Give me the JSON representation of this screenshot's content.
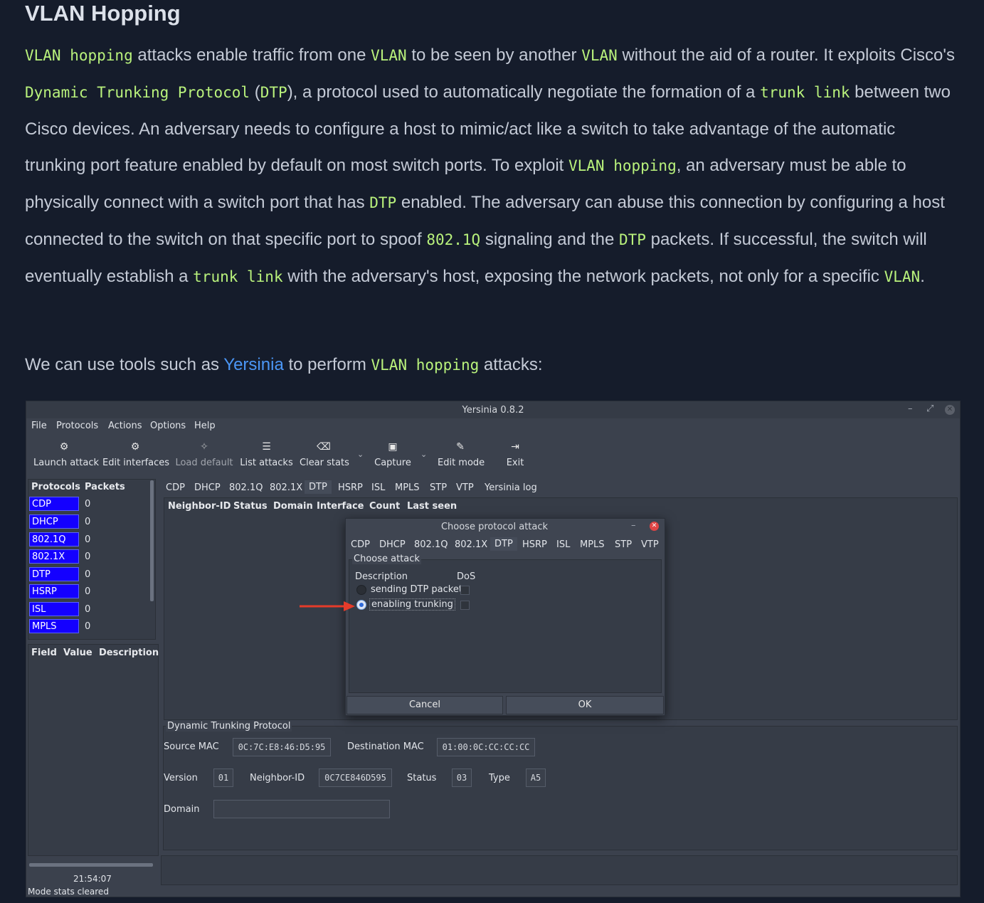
{
  "article": {
    "heading": "VLAN Hopping",
    "p1": {
      "s0": "VLAN hopping",
      "s1": " attacks enable traffic from one ",
      "s2": "VLAN",
      "s3": " to be seen by another ",
      "s4": "VLAN",
      "s5": " without the aid of a router. It exploits Cisco's ",
      "s6": "Dynamic Trunking Protocol",
      "s7": " (",
      "s8": "DTP",
      "s9": "), a protocol used to automatically negotiate the formation of a ",
      "s10": "trunk link",
      "s11": " between two Cisco devices. An adversary needs to configure a host to mimic/act like a switch to take advantage of the automatic trunking port feature enabled by default on most switch ports. To exploit ",
      "s12": "VLAN hopping",
      "s13": ", an adversary must be able to physically connect with a switch port that has ",
      "s14": "DTP",
      "s15": " enabled. The adversary can abuse this connection by configuring a host connected to the switch on that specific port to spoof ",
      "s16": "802.1Q",
      "s17": " signaling and the ",
      "s18": "DTP",
      "s19": " packets. If successful, the switch will eventually establish a ",
      "s20": "trunk link",
      "s21": " with the adversary's host, exposing the network packets, not only for a specific ",
      "s22": "VLAN",
      "s23": "."
    },
    "p2": {
      "s0": "We can use tools such as ",
      "link": "Yersinia",
      "s1": " to perform ",
      "code": "VLAN hopping",
      "s2": " attacks:"
    }
  },
  "app": {
    "title": "Yersinia 0.8.2",
    "window_controls": [
      "–",
      "⤢",
      "✕"
    ],
    "menu": [
      "File",
      "Protocols",
      "Actions",
      "Options",
      "Help"
    ],
    "toolbar": [
      {
        "label": "Launch attack",
        "icon": "gears-icon",
        "glyph": "⚙"
      },
      {
        "label": "Edit interfaces",
        "icon": "gears-icon",
        "glyph": "⚙"
      },
      {
        "label": "Load default",
        "icon": "wand-icon",
        "glyph": "✧"
      },
      {
        "label": "List attacks",
        "icon": "list-icon",
        "glyph": "☰"
      },
      {
        "label": "Clear stats",
        "icon": "backspace-icon",
        "glyph": "⌫"
      },
      {
        "label": "Capture",
        "icon": "floppy-icon",
        "glyph": "▣"
      },
      {
        "label": "Edit mode",
        "icon": "pencil-icon",
        "glyph": "✎"
      },
      {
        "label": "Exit",
        "icon": "exit-icon",
        "glyph": "⇥"
      }
    ],
    "protocols_panel": {
      "headers": [
        "Protocols",
        "Packets"
      ],
      "rows": [
        {
          "name": "CDP",
          "packets": "0"
        },
        {
          "name": "DHCP",
          "packets": "0"
        },
        {
          "name": "802.1Q",
          "packets": "0"
        },
        {
          "name": "802.1X",
          "packets": "0"
        },
        {
          "name": "DTP",
          "packets": "0"
        },
        {
          "name": "HSRP",
          "packets": "0"
        },
        {
          "name": "ISL",
          "packets": "0"
        },
        {
          "name": "MPLS",
          "packets": "0"
        }
      ]
    },
    "fields_panel": {
      "headers": [
        "Field",
        "Value",
        "Description"
      ]
    },
    "status": {
      "time": "21:54:07",
      "message": "Mode stats cleared"
    },
    "tabs": [
      "CDP",
      "DHCP",
      "802.1Q",
      "802.1X",
      "DTP",
      "HSRP",
      "ISL",
      "MPLS",
      "STP",
      "VTP",
      "Yersinia log"
    ],
    "active_tab": "DTP",
    "table_headers": [
      "Neighbor-ID",
      "Status",
      "Domain",
      "Interface",
      "Count",
      "Last seen"
    ],
    "dialog": {
      "title": "Choose protocol attack",
      "tabs": [
        "CDP",
        "DHCP",
        "802.1Q",
        "802.1X",
        "DTP",
        "HSRP",
        "ISL",
        "MPLS",
        "STP",
        "VTP"
      ],
      "active_tab": "DTP",
      "group_label": "Choose attack",
      "col_description": "Description",
      "col_dos": "DoS",
      "attacks": [
        {
          "label": "sending DTP packet",
          "selected": false,
          "dos": false
        },
        {
          "label": "enabling trunking",
          "selected": true,
          "dos": false
        }
      ],
      "cancel": "Cancel",
      "ok": "OK",
      "arrow_color": "#e53b2a"
    },
    "dtp_fields": {
      "section_title": "Dynamic Trunking Protocol",
      "source_mac_label": "Source MAC",
      "source_mac": "0C:7C:E8:46:D5:95",
      "dest_mac_label": "Destination MAC",
      "dest_mac": "01:00:0C:CC:CC:CC",
      "version_label": "Version",
      "version": "01",
      "neighbor_label": "Neighbor-ID",
      "neighbor": "0C7CE846D595",
      "status_label": "Status",
      "status": "03",
      "type_label": "Type",
      "type": "A5",
      "domain_label": "Domain",
      "domain": ""
    }
  },
  "colors": {
    "background": "#151c2b",
    "code": "#b9f27c",
    "link": "#4b96f5",
    "protocol_row": "#1400ff"
  }
}
